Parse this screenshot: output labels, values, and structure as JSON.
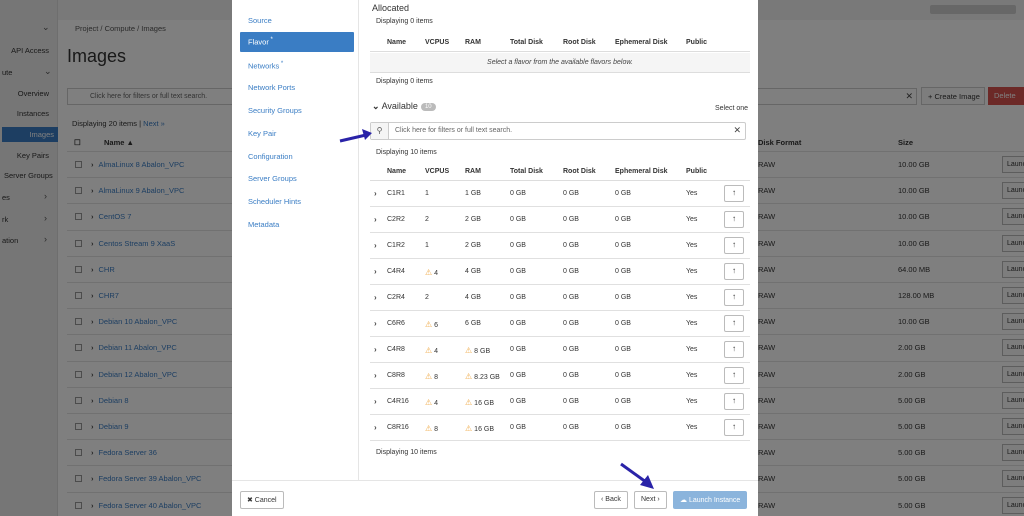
{
  "background": {
    "nav": [
      {
        "label": "API Access",
        "chev": false
      },
      {
        "label": "ute",
        "chev": true
      },
      {
        "label": "Overview",
        "chev": false
      },
      {
        "label": "Instances",
        "chev": false
      },
      {
        "label": "Images",
        "chev": false,
        "active": true
      },
      {
        "label": "Key Pairs",
        "chev": false
      },
      {
        "label": "Server Groups",
        "chev": false
      },
      {
        "label": "es",
        "chev": true
      },
      {
        "label": "rk",
        "chev": true
      },
      {
        "label": "ation",
        "chev": true
      }
    ],
    "breadcrumb": "Project /  Compute /  Images",
    "title": "Images",
    "filter_placeholder": "Click here for filters or full text search.",
    "create_label": "+ Create Image",
    "delete_label": "Delete",
    "count_text": "Displaying 20 items | ",
    "count_next": "Next »",
    "headers": {
      "name": "Name ▲",
      "format": "Disk Format",
      "size": "Size"
    },
    "rows": [
      {
        "name": "AlmaLinux 8 Abalon_VPC",
        "format": "RAW",
        "size": "10.00 GB",
        "action": "Launch"
      },
      {
        "name": "AlmaLinux 9 Abalon_VPC",
        "format": "RAW",
        "size": "10.00 GB",
        "action": "Launch"
      },
      {
        "name": "CentOS 7",
        "format": "RAW",
        "size": "10.00 GB",
        "action": "Launch"
      },
      {
        "name": "Centos Stream 9 XaaS",
        "format": "RAW",
        "size": "10.00 GB",
        "action": "Launch"
      },
      {
        "name": "CHR",
        "format": "RAW",
        "size": "64.00 MB",
        "action": "Launch"
      },
      {
        "name": "CHR7",
        "format": "RAW",
        "size": "128.00 MB",
        "action": "Launch"
      },
      {
        "name": "Debian 10 Abalon_VPC",
        "format": "RAW",
        "size": "10.00 GB",
        "action": "Launch"
      },
      {
        "name": "Debian 11 Abalon_VPC",
        "format": "RAW",
        "size": "2.00 GB",
        "action": "Launch"
      },
      {
        "name": "Debian 12 Abalon_VPC",
        "format": "RAW",
        "size": "2.00 GB",
        "action": "Launch"
      },
      {
        "name": "Debian 8",
        "format": "RAW",
        "size": "5.00 GB",
        "action": "Launch"
      },
      {
        "name": "Debian 9",
        "format": "RAW",
        "size": "5.00 GB",
        "action": "Launch"
      },
      {
        "name": "Fedora Server 36",
        "format": "RAW",
        "size": "5.00 GB",
        "action": "Launch"
      },
      {
        "name": "Fedora Server 39 Abalon_VPC",
        "format": "RAW",
        "size": "5.00 GB",
        "action": "Launch"
      },
      {
        "name": "Fedora Server 40 Abalon_VPC",
        "format": "RAW",
        "size": "5.00 GB",
        "action": "Launch"
      }
    ]
  },
  "modal": {
    "nav": [
      {
        "label": "Source",
        "required": false
      },
      {
        "label": "Flavor",
        "required": true,
        "active": true
      },
      {
        "label": "Networks",
        "required": true
      },
      {
        "label": "Network Ports",
        "required": false
      },
      {
        "label": "Security Groups",
        "required": false
      },
      {
        "label": "Key Pair",
        "required": false
      },
      {
        "label": "Configuration",
        "required": false
      },
      {
        "label": "Server Groups",
        "required": false
      },
      {
        "label": "Scheduler Hints",
        "required": false
      },
      {
        "label": "Metadata",
        "required": false
      }
    ],
    "allocated": {
      "title": "Allocated",
      "count_top": "Displaying 0 items",
      "headers": [
        "Name",
        "VCPUS",
        "RAM",
        "Total Disk",
        "Root Disk",
        "Ephemeral Disk",
        "Public"
      ],
      "empty_message": "Select a flavor from the available flavors below.",
      "count_bottom": "Displaying 0 items"
    },
    "available": {
      "title": "Available",
      "badge": "10",
      "select_hint": "Select one",
      "search_placeholder": "Click here for filters or full text search.",
      "count_top": "Displaying 10 items",
      "headers": [
        "Name",
        "VCPUS",
        "RAM",
        "Total Disk",
        "Root Disk",
        "Ephemeral Disk",
        "Public"
      ],
      "rows": [
        {
          "name": "C1R1",
          "vcpus": "1",
          "vcpus_warn": false,
          "ram": "1 GB",
          "ram_warn": false,
          "total": "0 GB",
          "root": "0 GB",
          "eph": "0 GB",
          "public": "Yes"
        },
        {
          "name": "C2R2",
          "vcpus": "2",
          "vcpus_warn": false,
          "ram": "2 GB",
          "ram_warn": false,
          "total": "0 GB",
          "root": "0 GB",
          "eph": "0 GB",
          "public": "Yes"
        },
        {
          "name": "C1R2",
          "vcpus": "1",
          "vcpus_warn": false,
          "ram": "2 GB",
          "ram_warn": false,
          "total": "0 GB",
          "root": "0 GB",
          "eph": "0 GB",
          "public": "Yes"
        },
        {
          "name": "C4R4",
          "vcpus": "4",
          "vcpus_warn": true,
          "ram": "4 GB",
          "ram_warn": false,
          "total": "0 GB",
          "root": "0 GB",
          "eph": "0 GB",
          "public": "Yes"
        },
        {
          "name": "C2R4",
          "vcpus": "2",
          "vcpus_warn": false,
          "ram": "4 GB",
          "ram_warn": false,
          "total": "0 GB",
          "root": "0 GB",
          "eph": "0 GB",
          "public": "Yes"
        },
        {
          "name": "C6R6",
          "vcpus": "6",
          "vcpus_warn": true,
          "ram": "6 GB",
          "ram_warn": false,
          "total": "0 GB",
          "root": "0 GB",
          "eph": "0 GB",
          "public": "Yes"
        },
        {
          "name": "C4R8",
          "vcpus": "4",
          "vcpus_warn": true,
          "ram": "8 GB",
          "ram_warn": true,
          "total": "0 GB",
          "root": "0 GB",
          "eph": "0 GB",
          "public": "Yes"
        },
        {
          "name": "C8R8",
          "vcpus": "8",
          "vcpus_warn": true,
          "ram": "8.23 GB",
          "ram_warn": true,
          "total": "0 GB",
          "root": "0 GB",
          "eph": "0 GB",
          "public": "Yes"
        },
        {
          "name": "C4R16",
          "vcpus": "4",
          "vcpus_warn": true,
          "ram": "16 GB",
          "ram_warn": true,
          "total": "0 GB",
          "root": "0 GB",
          "eph": "0 GB",
          "public": "Yes"
        },
        {
          "name": "C8R16",
          "vcpus": "8",
          "vcpus_warn": true,
          "ram": "16 GB",
          "ram_warn": true,
          "total": "0 GB",
          "root": "0 GB",
          "eph": "0 GB",
          "public": "Yes"
        }
      ],
      "count_bottom": "Displaying 10 items"
    },
    "footer": {
      "cancel": "✖ Cancel",
      "back": "‹ Back",
      "next": "Next ›",
      "launch": "Launch Instance"
    }
  },
  "colors": {
    "accent": "#3a7dc4",
    "launch": "#8bb4dc",
    "warning": "#f0ad4e",
    "annotation_arrow": "#2a23a8",
    "delete": "#d9534f"
  }
}
